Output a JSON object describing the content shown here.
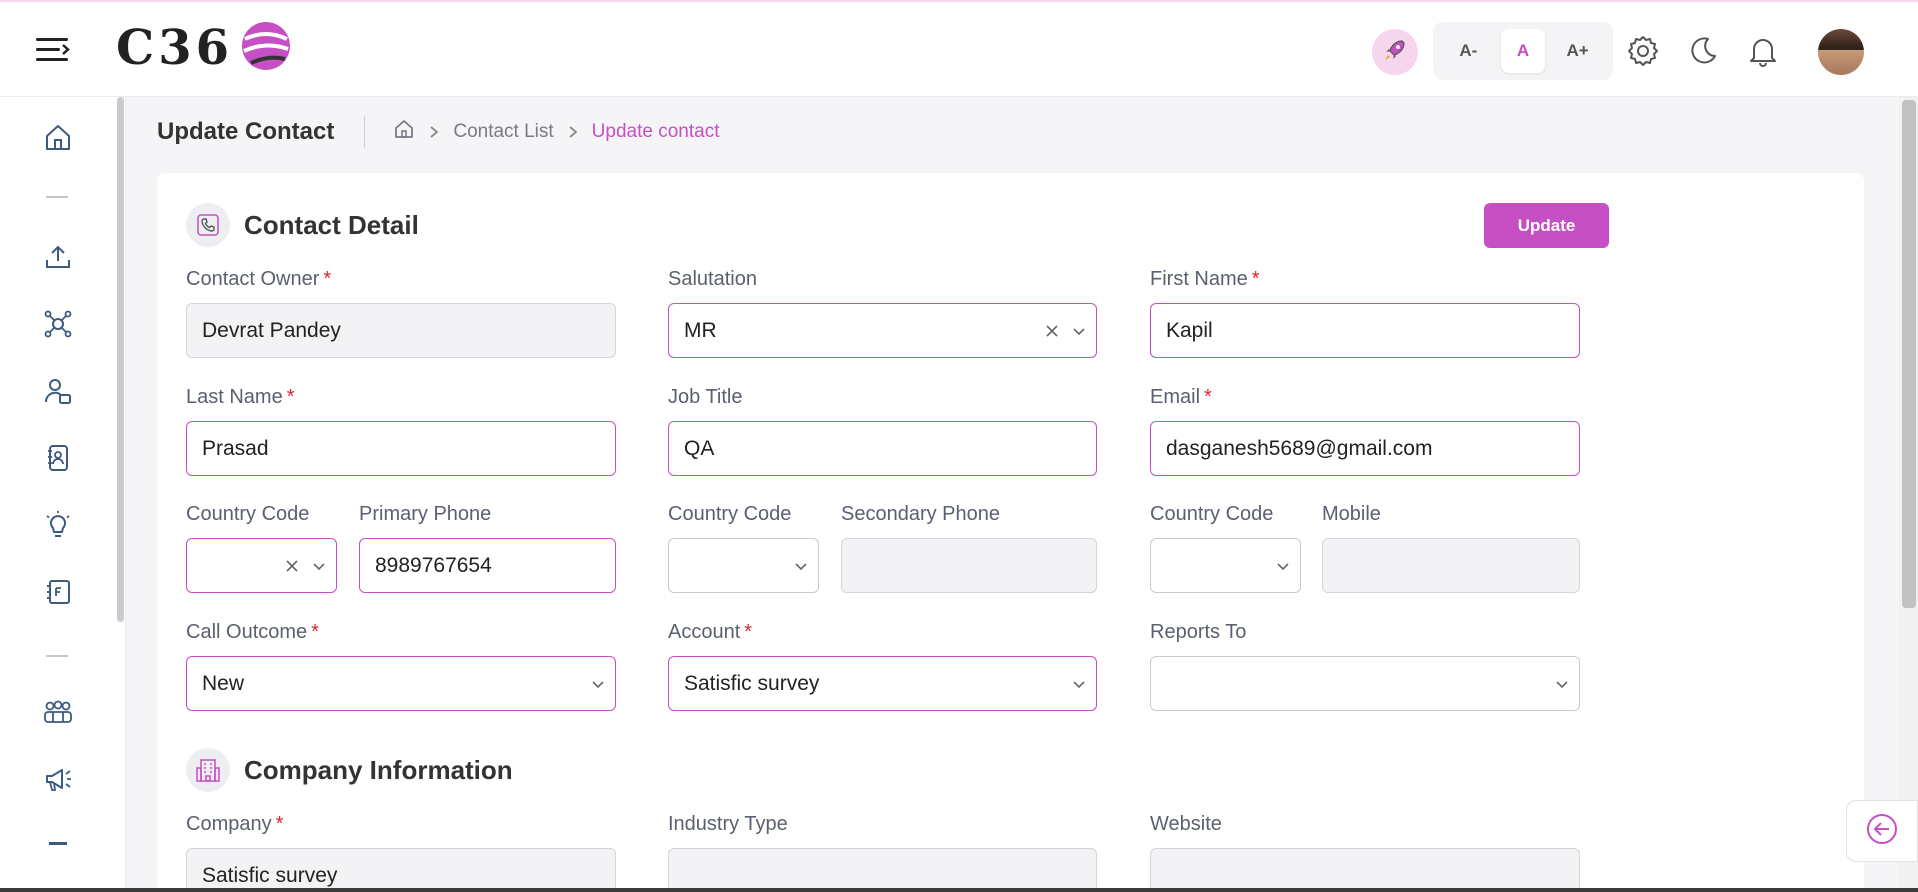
{
  "app": {
    "logo_text": "C36",
    "brand_color": "#c64fc3"
  },
  "toolbar": {
    "font_decrease": "A-",
    "font_default": "A",
    "font_increase": "A+",
    "icons": [
      "menu-icon",
      "rocket-icon",
      "gear-icon",
      "moon-icon",
      "bell-icon",
      "avatar"
    ]
  },
  "sidebar": {
    "icons": [
      "home-icon",
      "upload-icon",
      "network-icon",
      "contacts-icon",
      "phonebook-icon",
      "bulb-icon",
      "document-icon",
      "team-icon",
      "megaphone-icon"
    ]
  },
  "header": {
    "title": "Update Contact",
    "breadcrumb": {
      "home_icon": "home-icon",
      "list": "Contact List",
      "current": "Update contact"
    }
  },
  "contact_section": {
    "title": "Contact Detail",
    "icon": "phone-icon",
    "update_label": "Update"
  },
  "fields": {
    "contact_owner": {
      "label": "Contact Owner",
      "value": "Devrat Pandey",
      "required": "*"
    },
    "salutation": {
      "label": "Salutation",
      "value": "MR"
    },
    "first_name": {
      "label": "First Name",
      "value": "Kapil",
      "required": "*"
    },
    "last_name": {
      "label": "Last Name",
      "value": "Prasad",
      "required": "*"
    },
    "job_title": {
      "label": "Job Title",
      "value": "QA"
    },
    "email": {
      "label": "Email",
      "value": "dasganesh5689@gmail.com",
      "required": "*"
    },
    "country_code_1": {
      "label": "Country Code",
      "value": ""
    },
    "primary_phone": {
      "label": "Primary Phone",
      "value": "8989767654"
    },
    "country_code_2": {
      "label": "Country Code",
      "value": ""
    },
    "secondary_phone": {
      "label": "Secondary Phone",
      "value": ""
    },
    "country_code_3": {
      "label": "Country Code",
      "value": ""
    },
    "mobile": {
      "label": "Mobile",
      "value": ""
    },
    "call_outcome": {
      "label": "Call Outcome",
      "value": "New",
      "required": "*"
    },
    "account": {
      "label": "Account",
      "value": "Satisfic survey",
      "required": "*"
    },
    "reports_to": {
      "label": "Reports To",
      "value": ""
    }
  },
  "company_section": {
    "title": "Company Information",
    "icon": "building-icon"
  },
  "company_fields": {
    "company": {
      "label": "Company",
      "value": "Satisfic survey",
      "required": "*"
    },
    "industry_type": {
      "label": "Industry Type",
      "value": ""
    },
    "website": {
      "label": "Website",
      "value": ""
    }
  }
}
